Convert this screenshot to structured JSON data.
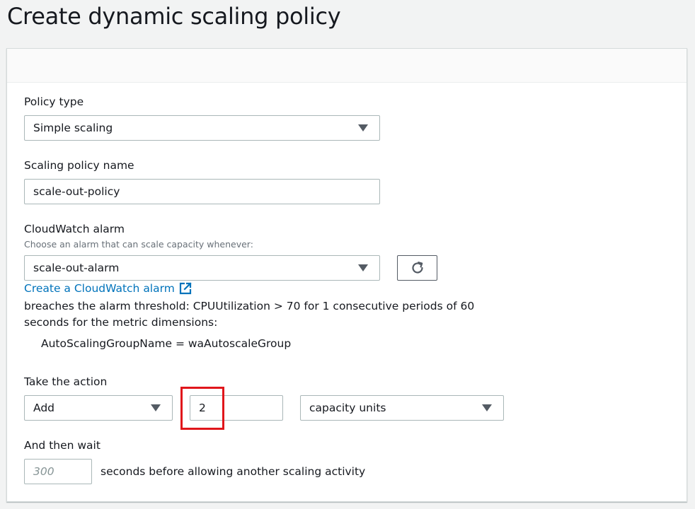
{
  "page": {
    "title": "Create dynamic scaling policy"
  },
  "form": {
    "policy_type": {
      "label": "Policy type",
      "value": "Simple scaling"
    },
    "policy_name": {
      "label": "Scaling policy name",
      "value": "scale-out-policy"
    },
    "alarm": {
      "label": "CloudWatch alarm",
      "description": "Choose an alarm that can scale capacity whenever:",
      "value": "scale-out-alarm",
      "create_link": "Create a CloudWatch alarm",
      "threshold_line1": "breaches the alarm threshold: CPUUtilization > 70 for 1 consecutive periods of 60",
      "threshold_line2": "seconds for the metric dimensions:",
      "dimension": "AutoScalingGroupName = waAutoscaleGroup"
    },
    "action": {
      "label": "Take the action",
      "operation": "Add",
      "amount": "2",
      "unit": "capacity units"
    },
    "wait": {
      "label": "And then wait",
      "placeholder": "300",
      "suffix": "seconds before allowing another scaling activity"
    }
  },
  "icons": {
    "refresh": "refresh-icon",
    "external_link": "external-link-icon",
    "dropdown": "caret-down-icon"
  },
  "colors": {
    "link": "#0073bb",
    "highlight": "#e0161b",
    "page_bg": "#f2f3f3"
  }
}
